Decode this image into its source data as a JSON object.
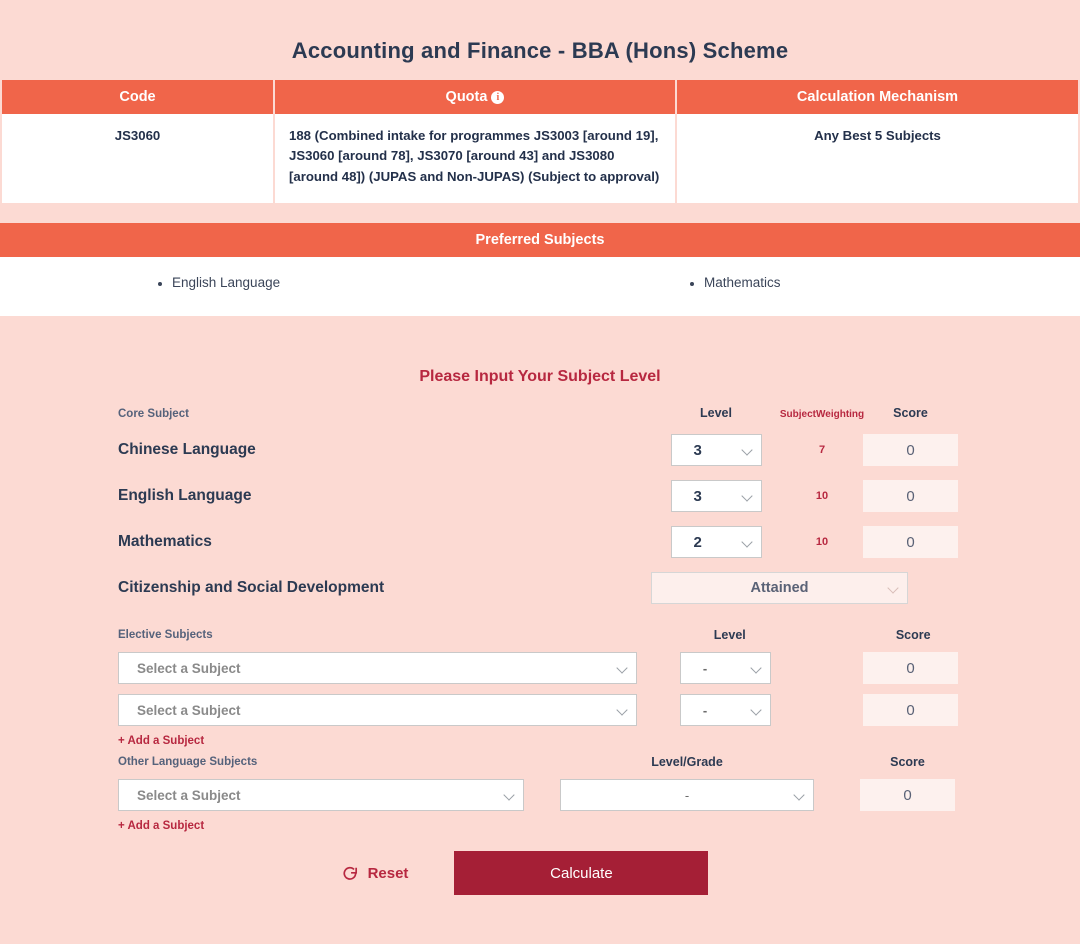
{
  "page": {
    "title": "Accounting and Finance - BBA (Hons) Scheme",
    "background_color": "#FCDAD3",
    "accent_orange": "#F0654A",
    "accent_crimson": "#B72840",
    "button_dark_red": "#A51F36"
  },
  "info_table": {
    "headers": {
      "code": "Code",
      "quota": "Quota",
      "quota_info_icon": "i",
      "mechanism": "Calculation Mechanism"
    },
    "row": {
      "code": "JS3060",
      "quota": "188 (Combined intake for programmes JS3003 [around 19], JS3060 [around 78], JS3070 [around 43] and JS3080 [around 48]) (JUPAS and Non-JUPAS) (Subject to approval)",
      "mechanism": "Any Best 5 Subjects"
    }
  },
  "preferred": {
    "bar_title": "Preferred Subjects",
    "items": [
      "English Language",
      "Mathematics"
    ]
  },
  "form": {
    "heading": "Please Input Your Subject Level",
    "core_header": {
      "subject": "Core Subject",
      "level": "Level",
      "weighting_line1": "Subject",
      "weighting_line2": "Weighting",
      "score": "Score"
    },
    "core_rows": [
      {
        "subject": "Chinese Language",
        "level": "3",
        "weighting": "7",
        "score": "0"
      },
      {
        "subject": "English Language",
        "level": "3",
        "weighting": "10",
        "score": "0"
      },
      {
        "subject": "Mathematics",
        "level": "2",
        "weighting": "10",
        "score": "0"
      }
    ],
    "citizenship": {
      "subject": "Citizenship and Social Development",
      "value": "Attained"
    },
    "elective_header": {
      "subject": "Elective Subjects",
      "level": "Level",
      "score": "Score"
    },
    "elective_rows": [
      {
        "subject_placeholder": "Select a Subject",
        "level": "-",
        "score": "0"
      },
      {
        "subject_placeholder": "Select a Subject",
        "level": "-",
        "score": "0"
      }
    ],
    "elective_add_link": "+ Add a Subject",
    "other_lang_header": {
      "subject": "Other Language Subjects",
      "level": "Level/Grade",
      "score": "Score"
    },
    "other_lang_rows": [
      {
        "subject_placeholder": "Select a Subject",
        "level": "-",
        "score": "0"
      }
    ],
    "other_lang_add_link": "+ Add a Subject",
    "actions": {
      "reset": "Reset",
      "reset_icon": "refresh-icon",
      "calculate": "Calculate"
    }
  }
}
